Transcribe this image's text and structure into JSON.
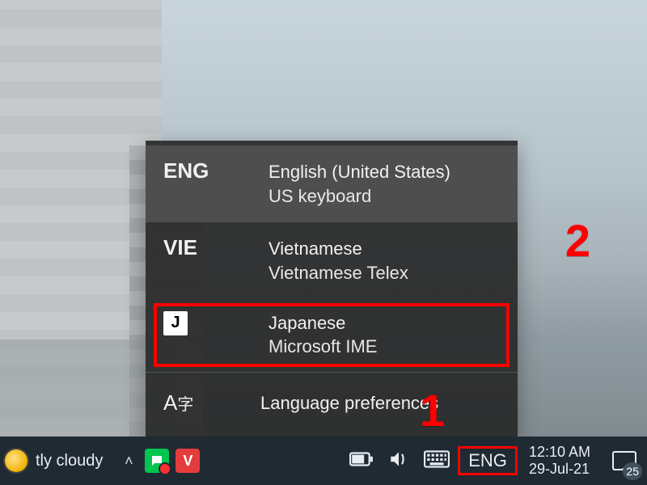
{
  "taskbar": {
    "weather_text": "tly cloudy",
    "lang_indicator": "ENG",
    "clock_time": "12:10 AM",
    "clock_date": "29-Jul-21",
    "action_center_count": "25"
  },
  "flyout": {
    "items": [
      {
        "code": "ENG",
        "title": "English (United States)",
        "sub": "US keyboard",
        "selected": true
      },
      {
        "code": "VIE",
        "title": "Vietnamese",
        "sub": "Vietnamese Telex",
        "selected": false
      },
      {
        "code": "J",
        "title": "Japanese",
        "sub": "Microsoft IME",
        "selected": false
      }
    ],
    "prefs_label": "Language preferences"
  },
  "callouts": {
    "one": "1",
    "two": "2"
  }
}
